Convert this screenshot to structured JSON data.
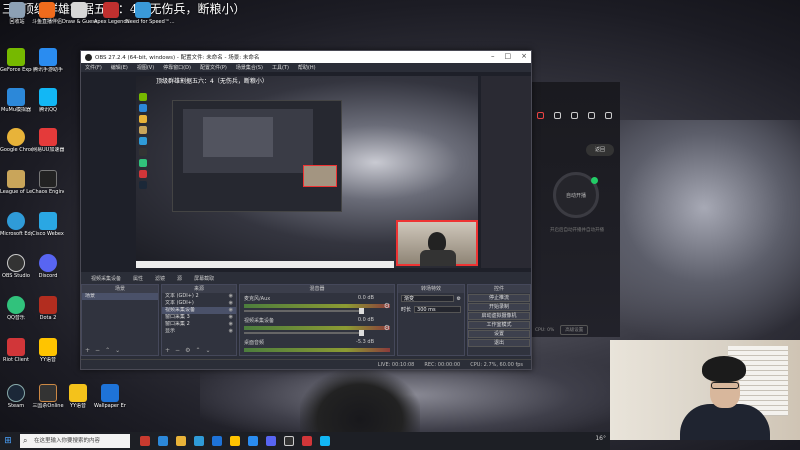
{
  "stream_title": {
    "number": "三",
    "text": "顶级群雄割据五六：4（无伤兵，断粮小）"
  },
  "desktop": {
    "top_icons": [
      {
        "label": "回收站",
        "color": "#8da1b5"
      },
      {
        "label": "斗鱼直播伴侣",
        "color": "#f06b1c"
      },
      {
        "label": "Draw & Guess",
        "color": "#d7d7d7"
      },
      {
        "label": "Apex Legends",
        "color": "#c0302f"
      },
      {
        "label": "Need for Speed™...",
        "color": "#3a9ad9"
      }
    ],
    "left_icons": [
      {
        "label": "GeForce Experience",
        "color": "#76b900"
      },
      {
        "label": "MuMu模拟器",
        "color": "#2c88d9"
      },
      {
        "label": "Google Chrome",
        "color": "#e8b339"
      },
      {
        "label": "League of Legends",
        "color": "#c9a55a"
      },
      {
        "label": "Microsoft Edge",
        "color": "#2f9bd8"
      },
      {
        "label": "OBS Studio",
        "color": "#333333"
      },
      {
        "label": "QQ音乐",
        "color": "#31c27c"
      },
      {
        "label": "Riot Client",
        "color": "#d13639"
      },
      {
        "label": "Steam",
        "color": "#1b2838"
      }
    ],
    "col2_icons": [
      {
        "label": "腾讯手游助手",
        "color": "#2a8cf0"
      },
      {
        "label": "腾讯QQ",
        "color": "#12b7f5"
      },
      {
        "label": "网易UU加速器",
        "color": "#e43a3a"
      },
      {
        "label": "Chaos Engine",
        "color": "#222222"
      },
      {
        "label": "Cisco Webex",
        "color": "#2aa7e3"
      },
      {
        "label": "Discord",
        "color": "#5865f2"
      },
      {
        "label": "Dota 2",
        "color": "#b22d1f"
      },
      {
        "label": "YY语音",
        "color": "#ffc400"
      },
      {
        "label": "三国杀Online",
        "color": "#333333"
      }
    ],
    "col3_icons": [
      {
        "label": "Wallpaper Engine",
        "color": "#1e73d8"
      },
      {
        "label": "YY语音",
        "color": "#f4c21b"
      }
    ]
  },
  "client_panel": {
    "pill_label": "返回",
    "ring_label": "自动开播",
    "desc": "开启后自动开播并自动开播",
    "bottom_left": "CPU: 0%",
    "bottom_box": "高级设置"
  },
  "obs": {
    "window_title": "OBS 27.2.4 (64-bit, windows) - 配置文件: 未命名 - 场景: 未命名",
    "controls": {
      "minimize": "–",
      "maximize": "□",
      "close": "×"
    },
    "menu": [
      "文件(F)",
      "编辑(E)",
      "视图(V)",
      "停靠窗口(D)",
      "配置文件(P)",
      "场景集合(S)",
      "工具(T)",
      "帮助(H)"
    ],
    "canvas_title": "顶级群雄割据五六：4（无伤兵，断粮小）",
    "dock_tabs": [
      "视频采集设备",
      "属性",
      "滤镜",
      "源",
      "屏幕截取"
    ],
    "scenes": {
      "title": "场景",
      "items": [
        "场景"
      ]
    },
    "sources": {
      "title": "来源",
      "items": [
        "文本 (GDI+) 2",
        "文本 (GDI+)",
        "视频采集设备",
        "窗口采集 3",
        "窗口采集 2",
        "显示"
      ]
    },
    "mixer": {
      "title": "混音器",
      "tracks": [
        {
          "name": "麦克风/Aux",
          "db": "0.0 dB"
        },
        {
          "name": "视频采集设备",
          "db": "0.0 dB"
        },
        {
          "name": "桌面音频",
          "db": "-5.3 dB"
        }
      ]
    },
    "transitions": {
      "title": "转场特效",
      "mode": "渐变",
      "duration_label": "时长",
      "duration": "300 ms"
    },
    "controls_dock": {
      "title": "控件",
      "buttons": [
        "停止推流",
        "开始录制",
        "启动虚拟摄像机",
        "工作室模式",
        "设置",
        "退出"
      ]
    },
    "status": {
      "live": "LIVE: 00:10:08",
      "rec": "REC: 00:00:00",
      "cpu": "CPU: 2.7%, 60.00 fps"
    }
  },
  "taskbar": {
    "search_placeholder": "在这里输入你要搜索的内容",
    "tray_temp": "16°"
  }
}
